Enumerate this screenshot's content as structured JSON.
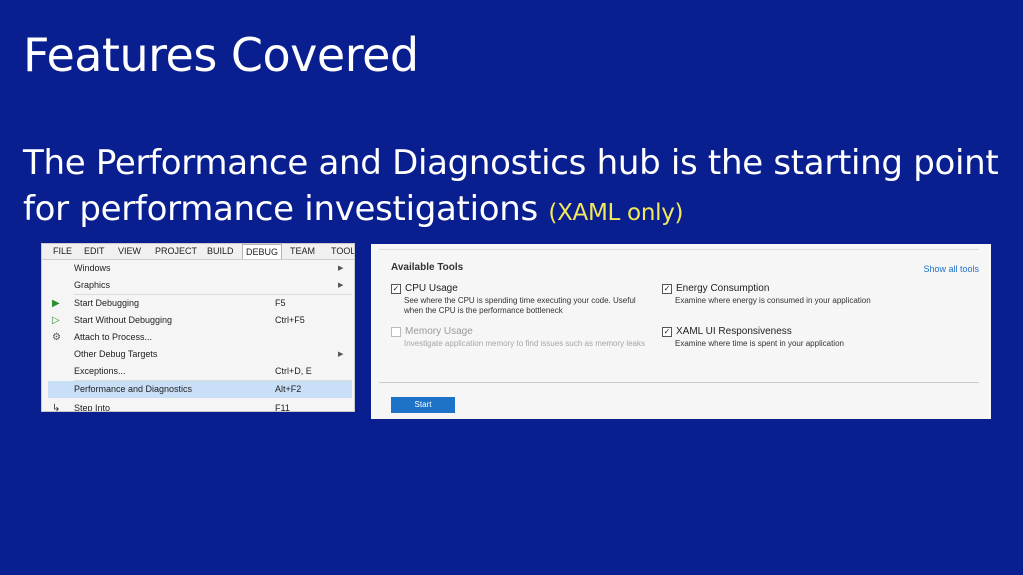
{
  "slide": {
    "title": "Features Covered",
    "subtitle": "The Performance and Diagnostics hub is the starting point for performance investigations",
    "subtitle_note": "(XAML only)",
    "colors": {
      "background": "#0a1f8f",
      "note": "#f2e85a"
    }
  },
  "vs_menu": {
    "menubar": [
      "FILE",
      "EDIT",
      "VIEW",
      "PROJECT",
      "BUILD",
      "DEBUG",
      "TEAM",
      "TOOL"
    ],
    "active": "DEBUG",
    "items": [
      {
        "label": "Windows",
        "shortcut": "",
        "submenu": true,
        "icon": ""
      },
      {
        "label": "Graphics",
        "shortcut": "",
        "submenu": true,
        "icon": ""
      },
      {
        "label": "Start Debugging",
        "shortcut": "F5",
        "submenu": false,
        "icon": "play-icon"
      },
      {
        "label": "Start Without Debugging",
        "shortcut": "Ctrl+F5",
        "submenu": false,
        "icon": "play-outline-icon"
      },
      {
        "label": "Attach to Process...",
        "shortcut": "",
        "submenu": false,
        "icon": "gears-icon"
      },
      {
        "label": "Other Debug Targets",
        "shortcut": "",
        "submenu": true,
        "icon": ""
      },
      {
        "label": "Exceptions...",
        "shortcut": "Ctrl+D, E",
        "submenu": false,
        "icon": ""
      },
      {
        "label": "Performance and Diagnostics",
        "shortcut": "Alt+F2",
        "submenu": false,
        "icon": "",
        "highlighted": true
      },
      {
        "label": "Step Into",
        "shortcut": "F11",
        "submenu": false,
        "icon": "step-into-icon"
      }
    ]
  },
  "tools_panel": {
    "title": "Available Tools",
    "show_all": "Show all tools",
    "tools": [
      {
        "name": "CPU Usage",
        "checked": true,
        "enabled": true,
        "description": "See where the CPU is spending time executing your code. Useful when the CPU is the performance bottleneck"
      },
      {
        "name": "Memory Usage",
        "checked": false,
        "enabled": false,
        "description": "Investigate application memory to find issues such as memory leaks"
      },
      {
        "name": "Energy Consumption",
        "checked": true,
        "enabled": true,
        "description": "Examine where energy is consumed in your application"
      },
      {
        "name": "XAML UI Responsiveness",
        "checked": true,
        "enabled": true,
        "description": "Examine where time is spent in your application"
      }
    ],
    "start_label": "Start"
  }
}
